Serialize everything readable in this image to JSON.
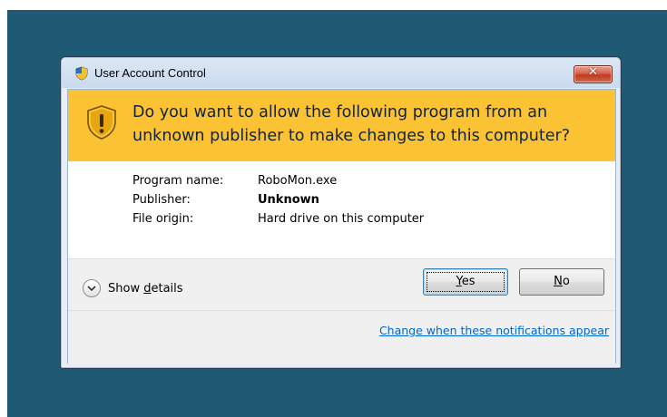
{
  "window": {
    "title": "User Account Control",
    "close_icon": "close-icon",
    "question": "Do you want to allow the following program from an unknown publisher to make changes to this computer?"
  },
  "details": {
    "program_name_label": "Program name:",
    "program_name_value": "RoboMon.exe",
    "publisher_label": "Publisher:",
    "publisher_value": "Unknown",
    "file_origin_label": "File origin:",
    "file_origin_value": "Hard drive on this computer"
  },
  "actions": {
    "show_details_prefix": "Show ",
    "show_details_mnemonic": "d",
    "show_details_suffix": "etails",
    "yes_mnemonic": "Y",
    "yes_suffix": "es",
    "no_mnemonic": "N",
    "no_suffix": "o",
    "notifications_link": "Change when these notifications appear"
  },
  "colors": {
    "desktop": "#1e5a74",
    "banner": "#fbc334",
    "link": "#0066cc",
    "close_button": "#c03a22"
  }
}
